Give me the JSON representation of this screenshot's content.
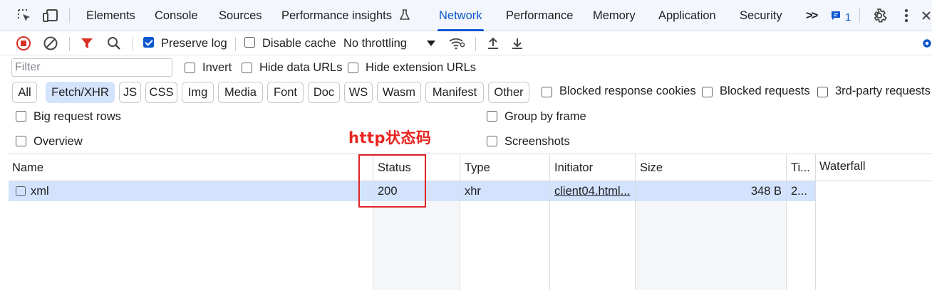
{
  "tabs": [
    {
      "label": "Elements",
      "active": false
    },
    {
      "label": "Console",
      "active": false
    },
    {
      "label": "Sources",
      "active": false
    },
    {
      "label": "Performance insights",
      "active": false
    },
    {
      "label": "Network",
      "active": true
    },
    {
      "label": "Performance",
      "active": false
    },
    {
      "label": "Memory",
      "active": false
    },
    {
      "label": "Application",
      "active": false
    },
    {
      "label": "Security",
      "active": false
    }
  ],
  "tabbar": {
    "more_tabs_glyph": ">>",
    "issues_count": "1",
    "accent_color": "#0b57d0"
  },
  "toolbar": {
    "preserve_log_label": "Preserve log",
    "preserve_log_checked": true,
    "disable_cache_label": "Disable cache",
    "disable_cache_checked": false,
    "throttling_value": "No throttling"
  },
  "filter": {
    "placeholder": "Filter",
    "invert_label": "Invert",
    "hide_data_urls_label": "Hide data URLs",
    "hide_extension_urls_label": "Hide extension URLs"
  },
  "types": [
    {
      "label": "All",
      "active": false
    },
    {
      "label": "Fetch/XHR",
      "active": true
    },
    {
      "label": "JS",
      "active": false
    },
    {
      "label": "CSS",
      "active": false
    },
    {
      "label": "Img",
      "active": false
    },
    {
      "label": "Media",
      "active": false
    },
    {
      "label": "Font",
      "active": false
    },
    {
      "label": "Doc",
      "active": false
    },
    {
      "label": "WS",
      "active": false
    },
    {
      "label": "Wasm",
      "active": false
    },
    {
      "label": "Manifest",
      "active": false
    },
    {
      "label": "Other",
      "active": false
    }
  ],
  "type_filters": {
    "blocked_response_cookies_label": "Blocked response cookies",
    "blocked_requests_label": "Blocked requests",
    "third_party_label": "3rd-party requests"
  },
  "settings": {
    "big_request_rows_label": "Big request rows",
    "group_by_frame_label": "Group by frame",
    "overview_label": "Overview",
    "screenshots_label": "Screenshots"
  },
  "table": {
    "columns": {
      "name": "Name",
      "status": "Status",
      "type": "Type",
      "initiator": "Initiator",
      "size": "Size",
      "time": "Ti...",
      "waterfall": "Waterfall"
    },
    "rows": [
      {
        "name": "xml",
        "status": "200",
        "type": "xhr",
        "initiator": "client04.html...",
        "size": "348 B",
        "time": "2..."
      }
    ],
    "selected_row_color": "#d3e3fd"
  },
  "annotation": {
    "text": "http状态码",
    "color": "#e8231f"
  }
}
